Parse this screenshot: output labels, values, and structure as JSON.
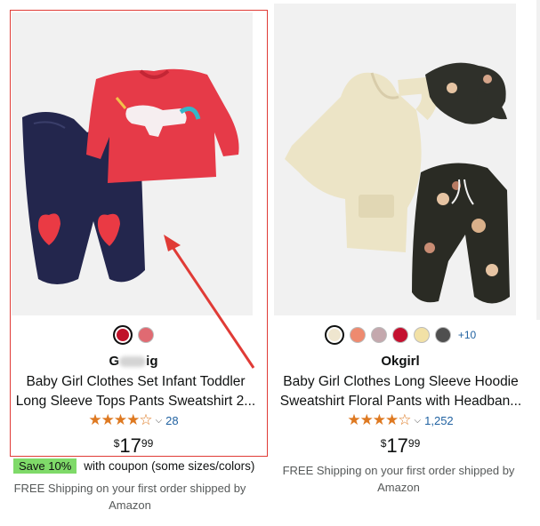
{
  "products": [
    {
      "brand_visible": "G",
      "brand_tail": "ig",
      "title_lines": [
        "Baby Girl Clothes Set Infant Toddler",
        "Long Sleeve Tops Pants Sweatshirt 2..."
      ],
      "swatches": [
        {
          "color": "#c0122a",
          "selected": true
        },
        {
          "color": "#e06a72",
          "selected": false
        }
      ],
      "more_swatches": "",
      "stars": "★★★★☆",
      "review_count": "28",
      "price": {
        "symbol": "$",
        "whole": "17",
        "cents": "99"
      },
      "coupon": {
        "badge": "Save 10%",
        "text": "with coupon (some sizes/colors)"
      },
      "shipping": "FREE Shipping on your first order shipped by Amazon"
    },
    {
      "brand": "Okgirl",
      "title_lines": [
        "Baby Girl Clothes Long Sleeve Hoodie",
        "Sweatshirt Floral Pants with Headban..."
      ],
      "swatches": [
        {
          "color": "#efe6cf",
          "selected": true
        },
        {
          "color": "#ee8a6f",
          "selected": false
        },
        {
          "color": "#c4a8ad",
          "selected": false
        },
        {
          "color": "#c4102f",
          "selected": false
        },
        {
          "color": "#f2e1a6",
          "selected": false
        },
        {
          "color": "#4f4f4f",
          "selected": false
        }
      ],
      "more_swatches": "+10",
      "stars": "★★★★☆",
      "review_count": "1,252",
      "price": {
        "symbol": "$",
        "whole": "17",
        "cents": "99"
      },
      "shipping": "FREE Shipping on your first order shipped by Amazon"
    }
  ],
  "colors": {
    "link": "#2162a1",
    "star": "#de7921",
    "highlight": "#e03b36",
    "coupon_badge": "#7fda69"
  }
}
